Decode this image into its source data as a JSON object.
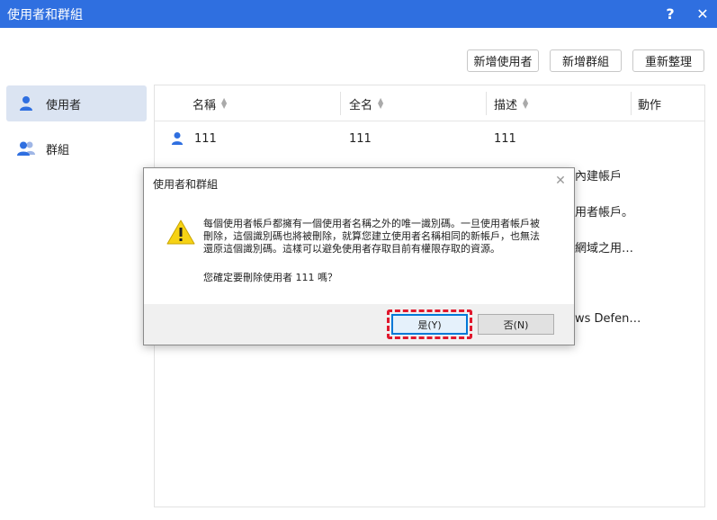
{
  "window": {
    "title": "使用者和群組",
    "help_label": "?",
    "close_label": "✕"
  },
  "toolbar": {
    "add_user": "新增使用者",
    "add_group": "新增群組",
    "refresh": "重新整理"
  },
  "sidebar": {
    "items": [
      {
        "label": "使用者",
        "icon": "user-icon",
        "active": true
      },
      {
        "label": "群組",
        "icon": "group-icon",
        "active": false
      }
    ]
  },
  "table": {
    "columns": [
      {
        "label": "名稱",
        "sortable": true
      },
      {
        "label": "全名",
        "sortable": true
      },
      {
        "label": "描述",
        "sortable": true
      },
      {
        "label": "動作",
        "sortable": false
      }
    ],
    "rows": [
      {
        "name": "111",
        "fullname": "111",
        "desc": "111"
      },
      {
        "desc": "內建帳戶"
      },
      {
        "desc": "用者帳戶。"
      },
      {
        "desc": "網域之用…"
      },
      {
        "desc": "ws Defen…"
      }
    ]
  },
  "dialog": {
    "title": "使用者和群組",
    "close_label": "✕",
    "message": "每個使用者帳戶都擁有一個使用者名稱之外的唯一識別碼。一旦使用者帳戶被刪除，這個識別碼也將被刪除，就算您建立使用者名稱相同的新帳戶，也無法還原這個識別碼。這樣可以避免使用者存取目前有權限存取的資源。",
    "question": "您確定要刪除使用者 111 嗎？",
    "yes_label": "是(Y)",
    "no_label": "否(N)"
  },
  "colors": {
    "titlebar": "#2f6fe0",
    "accent": "#2f6fe0",
    "sidebar_active": "#dbe4f2",
    "highlight": "#e0182d",
    "warning": "#f6d214"
  }
}
